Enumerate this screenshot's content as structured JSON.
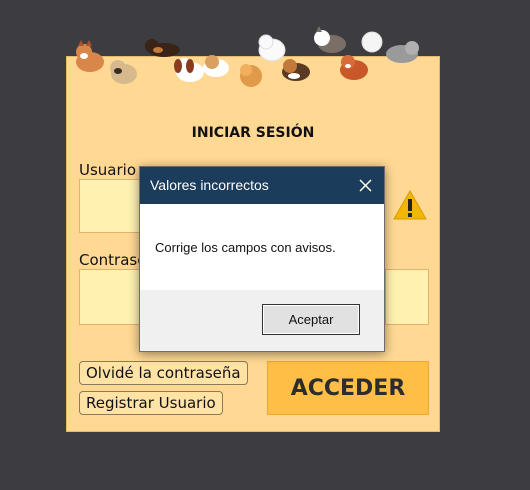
{
  "login": {
    "title": "INICIAR SESIÓN",
    "user_label": "Usuario",
    "password_label": "Contraseña",
    "forgot_label": "Olvidé la contraseña",
    "register_label": "Registrar Usuario",
    "submit_label": "ACCEDER"
  },
  "dialog": {
    "title": "Valores incorrectos",
    "message": "Corrige los campos con avisos.",
    "ok_label": "Aceptar"
  },
  "colors": {
    "background": "#3d3d41",
    "panel": "#ffd993",
    "input": "#fff2b0",
    "accent_button": "#ffbe45",
    "dialog_titlebar": "#1c3c5c",
    "warning": "#f2b705"
  },
  "icons": {
    "warning": "warning-icon",
    "close": "close-icon",
    "banner": "dogs-banner"
  }
}
